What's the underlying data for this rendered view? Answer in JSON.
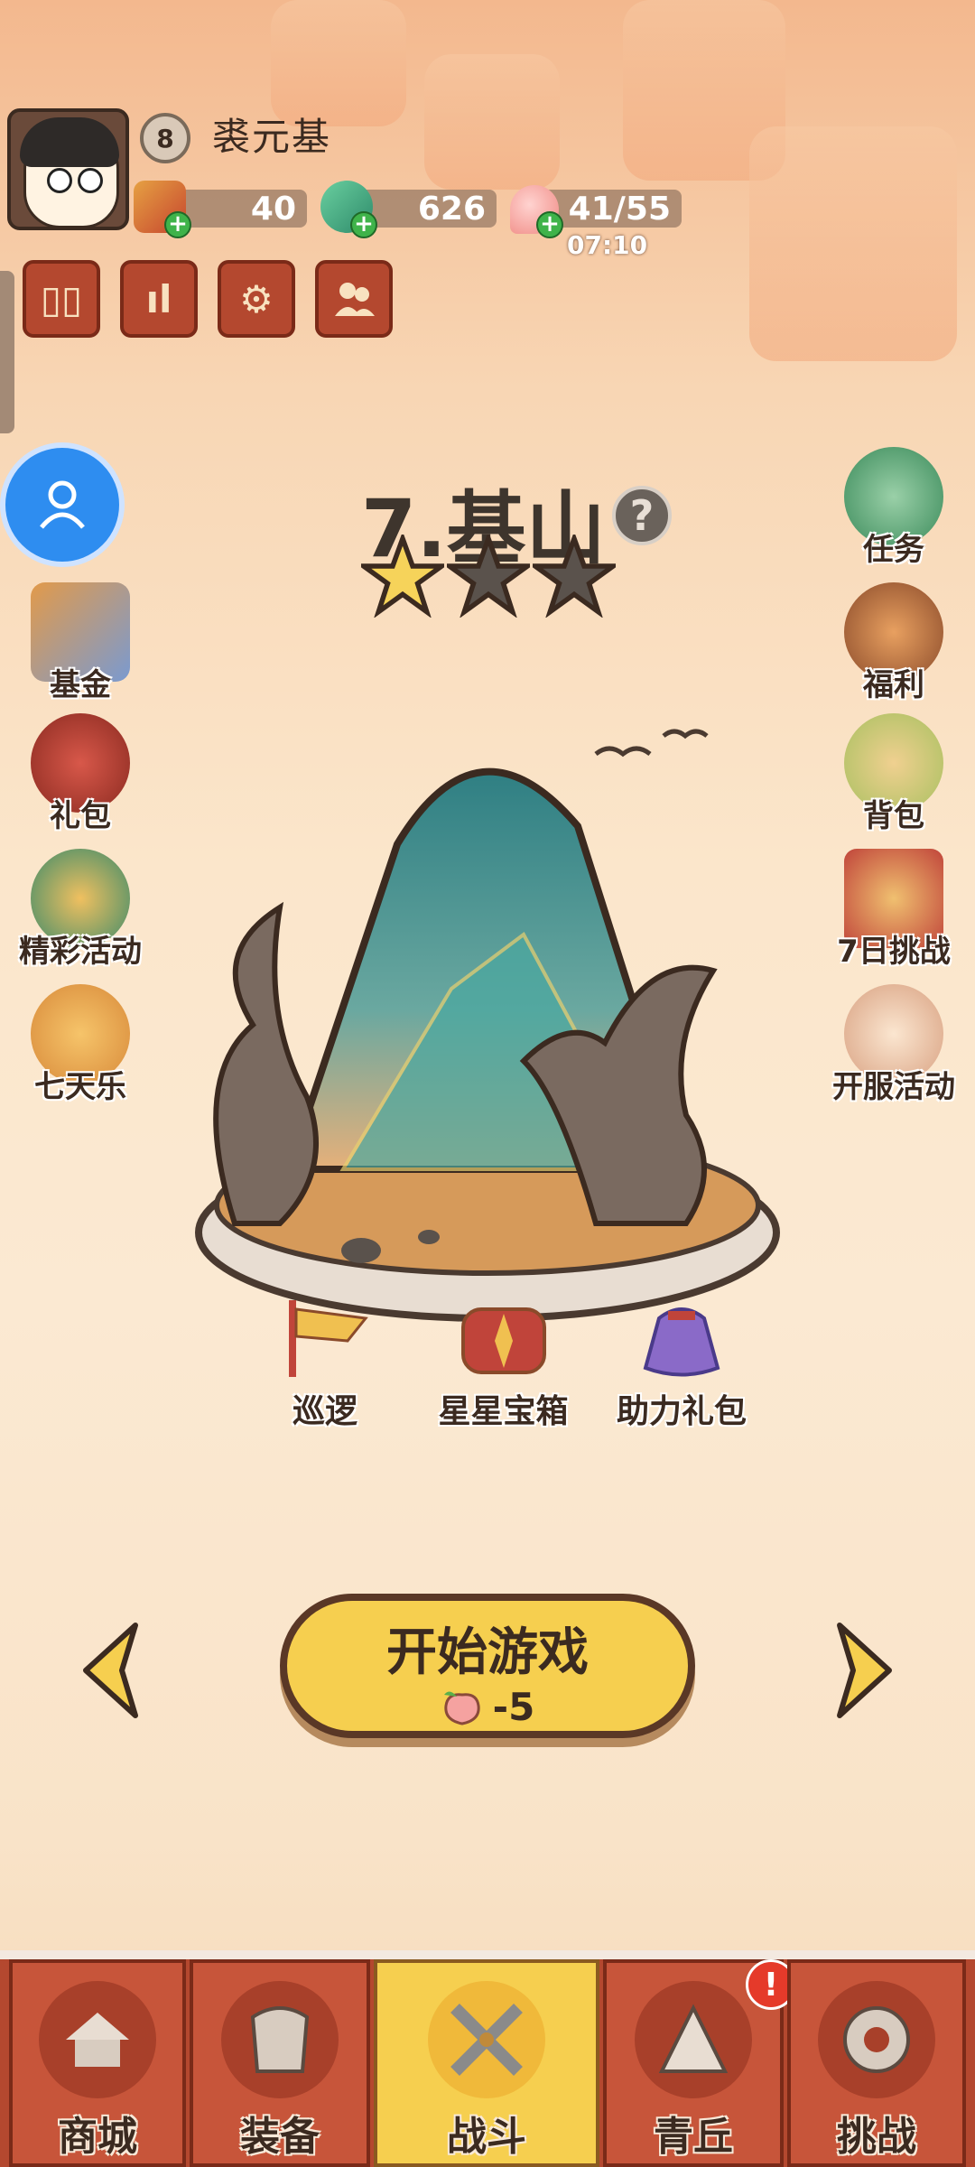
{
  "player": {
    "level": "8",
    "name": "裘元基"
  },
  "resources": {
    "scroll": {
      "value": "40",
      "icon": "scroll-coin-icon"
    },
    "jade": {
      "value": "626",
      "icon": "jade-fish-icon"
    },
    "stamina": {
      "value": "41/55",
      "icon": "peach-icon",
      "timer": "07:10"
    }
  },
  "toolbar": [
    {
      "icon": "card-icon",
      "glyph": "▯▯"
    },
    {
      "icon": "ranking-icon",
      "glyph": "ıl"
    },
    {
      "icon": "settings-gear-icon",
      "glyph": "⚙"
    },
    {
      "icon": "friends-icon",
      "glyph": "👥"
    }
  ],
  "left_menu": [
    {
      "label": "基金",
      "icon": "fund-icon"
    },
    {
      "label": "礼包",
      "icon": "gift-pack-icon"
    },
    {
      "label": "精彩活动",
      "icon": "event-icon"
    },
    {
      "label": "七天乐",
      "icon": "seven-day-icon"
    }
  ],
  "right_menu": [
    {
      "label": "任务",
      "icon": "quest-scroll-icon"
    },
    {
      "label": "福利",
      "icon": "welfare-bag-icon"
    },
    {
      "label": "背包",
      "icon": "backpack-icon"
    },
    {
      "label": "7日挑战",
      "icon": "seven-day-challenge-icon"
    },
    {
      "label": "开服活动",
      "icon": "server-open-event-icon"
    }
  ],
  "stage": {
    "title": "7.基山",
    "stars_earned": 1,
    "stars_total": 3
  },
  "stage_items": [
    {
      "label": "巡逻",
      "icon": "patrol-flag-icon"
    },
    {
      "label": "星星宝箱",
      "icon": "star-chest-icon"
    },
    {
      "label": "助力礼包",
      "icon": "support-gift-bag-icon"
    }
  ],
  "start": {
    "label": "开始游戏",
    "cost": "-5"
  },
  "bottom_nav": [
    {
      "label": "商城",
      "icon": "shop-icon",
      "active": false
    },
    {
      "label": "装备",
      "icon": "equipment-icon",
      "active": false
    },
    {
      "label": "战斗",
      "icon": "battle-swords-icon",
      "active": true
    },
    {
      "label": "青丘",
      "icon": "qingqiu-icon",
      "active": false,
      "alert": "!"
    },
    {
      "label": "挑战",
      "icon": "challenge-icon",
      "active": false
    }
  ],
  "colors": {
    "accent_red": "#b4482f",
    "accent_gold": "#f6cf4f",
    "text_dark": "#3b2a20"
  }
}
